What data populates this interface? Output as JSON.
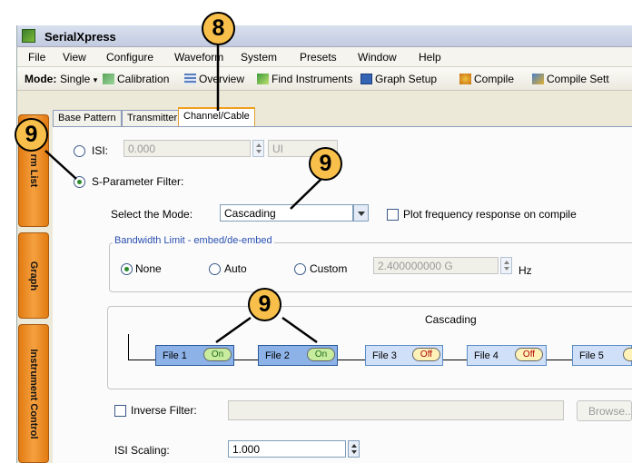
{
  "app": {
    "title": "SerialXpress"
  },
  "menu": [
    "File",
    "View",
    "Configure",
    "Waveform",
    "System",
    "Presets",
    "Window",
    "Help"
  ],
  "toolbar": {
    "mode_label": "Mode:",
    "mode_value": "Single",
    "buttons": [
      "Calibration",
      "Overview",
      "Find Instruments",
      "Graph Setup",
      "Compile",
      "Compile Sett"
    ]
  },
  "tabs": [
    "Base Pattern",
    "Transmitter",
    "Channel/Cable"
  ],
  "active_tab": "Channel/Cable",
  "sidebar": [
    "rm List",
    "Graph",
    "Instrument Control"
  ],
  "isi": {
    "label": "ISI:",
    "value": "0.000",
    "unit": "UI",
    "selected": false
  },
  "sparam": {
    "label": "S-Parameter Filter:",
    "selected": true,
    "mode_label": "Select the Mode:",
    "mode_value": "Cascading",
    "plot_label": "Plot frequency response on compile",
    "plot_checked": false
  },
  "bandwidth": {
    "title": "Bandwidth Limit - embed/de-embed",
    "options": [
      "None",
      "Auto",
      "Custom"
    ],
    "selected": "None",
    "custom_value": "2.400000000 G",
    "unit": "Hz"
  },
  "cascade": {
    "title": "Cascading",
    "files": [
      {
        "label": "File 1",
        "state": "On",
        "active": true
      },
      {
        "label": "File 2",
        "state": "On",
        "active": true
      },
      {
        "label": "File 3",
        "state": "Off",
        "active": false
      },
      {
        "label": "File 4",
        "state": "Off",
        "active": false
      },
      {
        "label": "File 5",
        "state": "",
        "active": false
      }
    ]
  },
  "inverse": {
    "label": "Inverse Filter:",
    "checked": false,
    "browse_label": "Browse..."
  },
  "isi_scaling": {
    "label": "ISI Scaling:",
    "value": "1.000"
  },
  "callouts": [
    "8",
    "9",
    "9",
    "9"
  ]
}
